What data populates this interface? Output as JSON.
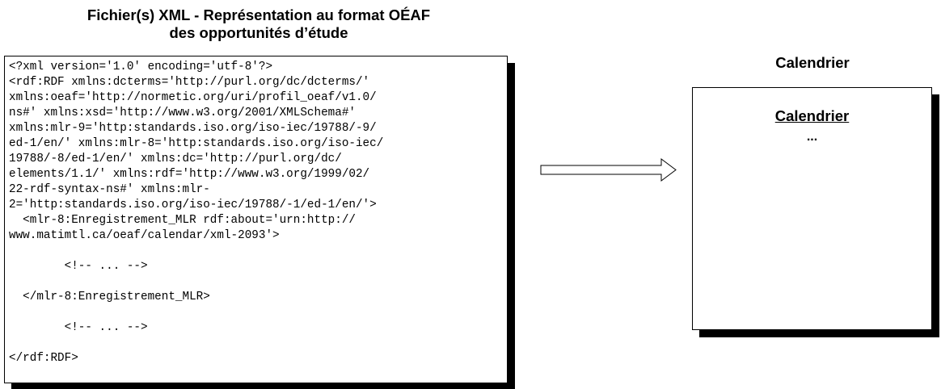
{
  "left": {
    "title_line1": "Fichier(s) XML - Représentation au format OÉAF",
    "title_line2": "des opportunités d’étude",
    "xml_lines": [
      "<?xml version='1.0' encoding='utf-8'?>",
      "<rdf:RDF xmlns:dcterms='http://purl.org/dc/dcterms/'",
      "xmlns:oeaf='http://normetic.org/uri/profil_oeaf/v1.0/",
      "ns#' xmlns:xsd='http://www.w3.org/2001/XMLSchema#'",
      "xmlns:mlr-9='http:standards.iso.org/iso-iec/19788/-9/",
      "ed-1/en/' xmlns:mlr-8='http:standards.iso.org/iso-iec/",
      "19788/-8/ed-1/en/' xmlns:dc='http://purl.org/dc/",
      "elements/1.1/' xmlns:rdf='http://www.w3.org/1999/02/",
      "22-rdf-syntax-ns#' xmlns:mlr-",
      "2='http:standards.iso.org/iso-iec/19788/-1/ed-1/en/'>",
      "  <mlr-8:Enregistrement_MLR rdf:about='urn:http://",
      "www.matimtl.ca/oeaf/calendar/xml-2093'>",
      "",
      "        <!-- ... -->",
      "",
      "  </mlr-8:Enregistrement_MLR>",
      "",
      "        <!-- ... -->",
      "",
      "</rdf:RDF>"
    ]
  },
  "right": {
    "title": "Calendrier",
    "box_heading": "Calendrier",
    "box_content": "..."
  }
}
